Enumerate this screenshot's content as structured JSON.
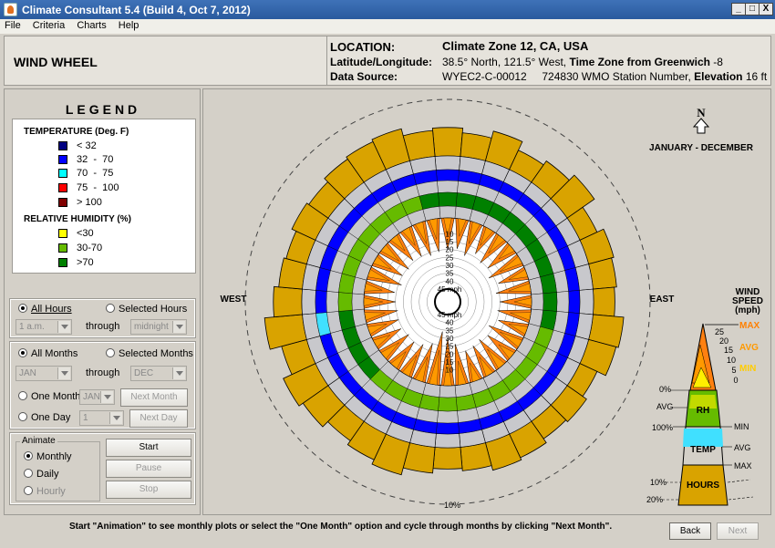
{
  "window": {
    "title": "Climate Consultant 5.4 (Build 4, Oct 7, 2012)",
    "controls": {
      "minimize": "_",
      "maximize": "□",
      "close": "X"
    }
  },
  "menu": [
    "File",
    "Criteria",
    "Charts",
    "Help"
  ],
  "header": {
    "view_title": "WIND WHEEL",
    "location_label": "LOCATION:",
    "location_value": "Climate Zone 12, CA, USA",
    "latlon_label": "Latitude/Longitude:",
    "latlon_value": "38.5° North, 121.5° West,",
    "timezone_label": "Time Zone from Greenwich",
    "timezone_value": "-8",
    "source_label": "Data Source:",
    "source_id": "WYEC2-C-00012",
    "station": "724830 WMO Station Number,",
    "elevation_label": "Elevation",
    "elevation_value": "16 ft"
  },
  "legend": {
    "title": "LEGEND",
    "temp_header": "TEMPERATURE (Deg. F)",
    "temp_items": [
      {
        "label": "< 32",
        "color": "#000080"
      },
      {
        "label": "32  -  70",
        "color": "#0000ff"
      },
      {
        "label": "70  -  75",
        "color": "#00ffff"
      },
      {
        "label": "75  -  100",
        "color": "#ff0000"
      },
      {
        "label": "> 100",
        "color": "#800000"
      }
    ],
    "rh_header": "RELATIVE HUMIDITY (%)",
    "rh_items": [
      {
        "label": "<30",
        "color": "#ffff00"
      },
      {
        "label": "30-70",
        "color": "#66bb00"
      },
      {
        "label": ">70",
        "color": "#008000"
      }
    ]
  },
  "hours": {
    "all_label": "All Hours",
    "selected_label": "Selected Hours",
    "from": "1 a.m.",
    "through": "through",
    "to": "midnight"
  },
  "months": {
    "all_label": "All Months",
    "selected_label": "Selected Months",
    "from": "JAN",
    "through": "through",
    "to": "DEC",
    "one_month_label": "One Month",
    "one_month_value": "JAN",
    "next_month": "Next Month",
    "one_day_label": "One Day",
    "one_day_value": "1",
    "next_day": "Next Day"
  },
  "animate": {
    "legend": "Animate",
    "monthly": "Monthly",
    "daily": "Daily",
    "hourly": "Hourly",
    "start": "Start",
    "pause": "Pause",
    "stop": "Stop"
  },
  "chart": {
    "north": "N",
    "period": "JANUARY - DECEMBER",
    "west": "WEST",
    "east": "EAST",
    "percent_label": "10%",
    "speed_labels_upper": [
      "10",
      "15",
      "20",
      "25",
      "30",
      "35",
      "40",
      "45 mph"
    ],
    "speed_labels_lower": [
      "45 mph",
      "40",
      "35",
      "30",
      "25",
      "20",
      "15",
      "10"
    ]
  },
  "key": {
    "title_lines": [
      "WIND",
      "SPEED",
      "(mph)"
    ],
    "speed_ticks": [
      "25",
      "20",
      "15",
      "10",
      "5",
      "0"
    ],
    "max": "MAX",
    "avg": "AVG",
    "min": "MIN",
    "rh_zero": "0%",
    "rh_avg": "AVG",
    "rh_hundred": "100%",
    "rh_label": "RH",
    "temp_min": "MIN",
    "temp_avg": "AVG",
    "temp_max": "MAX",
    "temp_label": "TEMP",
    "hours_10": "10%",
    "hours_20": "20%",
    "hours_label": "HOURS",
    "colors": {
      "max": "#ff8000",
      "avg": "#ff9900",
      "min": "#ffcc00",
      "wedge": "#ff8010",
      "rh": "#66bb00",
      "temp": "#40e0ff",
      "hours": "#d9a300"
    }
  },
  "status": {
    "message": "Start \"Animation\" to see monthly plots or select the \"One Month\" option and cycle through months by clicking \"Next Month\".",
    "back": "Back",
    "next": "Next"
  },
  "chart_data": {
    "type": "wind-wheel",
    "directions": 36,
    "hours_pct": [
      12,
      10,
      13,
      9,
      11,
      14,
      8,
      11,
      10,
      9,
      13,
      12,
      8,
      10,
      9,
      11,
      12,
      10,
      9,
      11,
      14,
      12,
      10,
      13,
      15,
      11,
      16,
      12,
      10,
      9,
      11,
      10,
      12,
      13,
      14,
      11
    ],
    "temp_band": [
      "gray",
      "gray",
      "gray",
      "gray",
      "gray",
      "gray",
      "gray",
      "gray",
      "gray",
      "gray",
      "gray",
      "gray",
      "gray",
      "gray",
      "gray",
      "gray",
      "gray",
      "gray",
      "gray",
      "gray",
      "gray",
      "gray",
      "gray",
      "gray",
      "gray",
      "gray",
      "gray",
      "gray",
      "gray",
      "gray",
      "gray",
      "gray",
      "gray",
      "gray",
      "gray",
      "gray"
    ],
    "temp_32_70": [
      "blue",
      "blue",
      "blue",
      "blue",
      "blue",
      "blue",
      "blue",
      "blue",
      "blue",
      "blue",
      "blue",
      "blue",
      "blue",
      "blue",
      "blue",
      "blue",
      "blue",
      "blue",
      "blue",
      "blue",
      "blue",
      "blue",
      "blue",
      "blue",
      "blue",
      "blue",
      "cyan",
      "blue",
      "blue",
      "blue",
      "blue",
      "blue",
      "blue",
      "blue",
      "blue",
      "blue"
    ],
    "rh_band": [
      "green",
      "green",
      "green",
      "green",
      "green",
      "green",
      "green",
      "green",
      "green",
      "green",
      "green",
      "lime",
      "lime",
      "lime",
      "lime",
      "lime",
      "lime",
      "lime",
      "lime",
      "lime",
      "lime",
      "lime",
      "lime",
      "green",
      "green",
      "green",
      "green",
      "lime",
      "lime",
      "lime",
      "lime",
      "lime",
      "lime",
      "lime",
      "lime",
      "green"
    ],
    "avg_speed": [
      12,
      11,
      14,
      12,
      13,
      11,
      15,
      12,
      14,
      11,
      13,
      12,
      15,
      11,
      14,
      13,
      12,
      15,
      18,
      22,
      16,
      14,
      12,
      13,
      11,
      12,
      13,
      12,
      11,
      14,
      12,
      13,
      11,
      12,
      14,
      13
    ],
    "max_speed": [
      20,
      19,
      22,
      18,
      21,
      20,
      23,
      19,
      22,
      20,
      21,
      19,
      23,
      20,
      22,
      21,
      20,
      26,
      30,
      34,
      25,
      22,
      20,
      21,
      19,
      20,
      21,
      20,
      19,
      22,
      20,
      21,
      19,
      20,
      22,
      21
    ]
  }
}
